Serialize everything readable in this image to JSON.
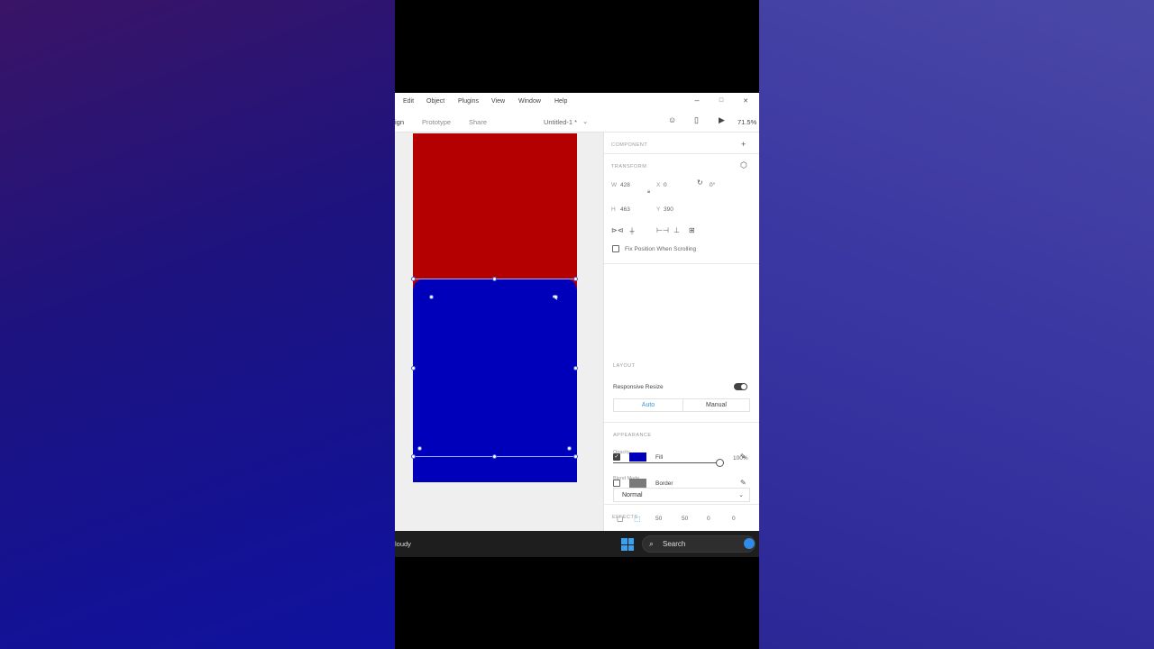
{
  "menu": {
    "items": [
      "Edit",
      "Object",
      "Plugins",
      "View",
      "Window",
      "Help"
    ],
    "window_controls": [
      "–",
      "□",
      "✕"
    ]
  },
  "toolbar": {
    "tabs": [
      "ign",
      "Prototype",
      "Share"
    ],
    "document_title": "Untitled-1 *",
    "zoom": "71.5%"
  },
  "artboard": {
    "top_color": "#b40000",
    "bottom_color": "#0000bb"
  },
  "panel": {
    "component_label": "COMPONENT",
    "transform_label": "TRANSFORM",
    "w_label": "W",
    "w_value": "428",
    "x_label": "X",
    "x_value": "0",
    "rotation_value": "0°",
    "h_label": "H",
    "h_value": "463",
    "y_label": "Y",
    "y_value": "390",
    "fix_position_label": "Fix Position When Scrolling",
    "layout_label": "LAYOUT",
    "responsive_resize_label": "Responsive Resize",
    "auto_label": "Auto",
    "manual_label": "Manual",
    "appearance_label": "APPEARANCE",
    "opacity_label": "Opacity",
    "opacity_value": "100%",
    "opacity_level": 1.0,
    "blend_mode_label": "Blend Mode",
    "blend_mode_value": "Normal",
    "corner_values": [
      "50",
      "50",
      "0",
      "0"
    ],
    "fill_label": "Fill",
    "fill_color": "#0000bb",
    "fill_checked": true,
    "border_label": "Border",
    "border_color": "#7a7a7a",
    "border_checked": false,
    "effects_label": "EFFECTS"
  },
  "taskbar": {
    "left_text": "loudy",
    "search_label": "Search"
  }
}
